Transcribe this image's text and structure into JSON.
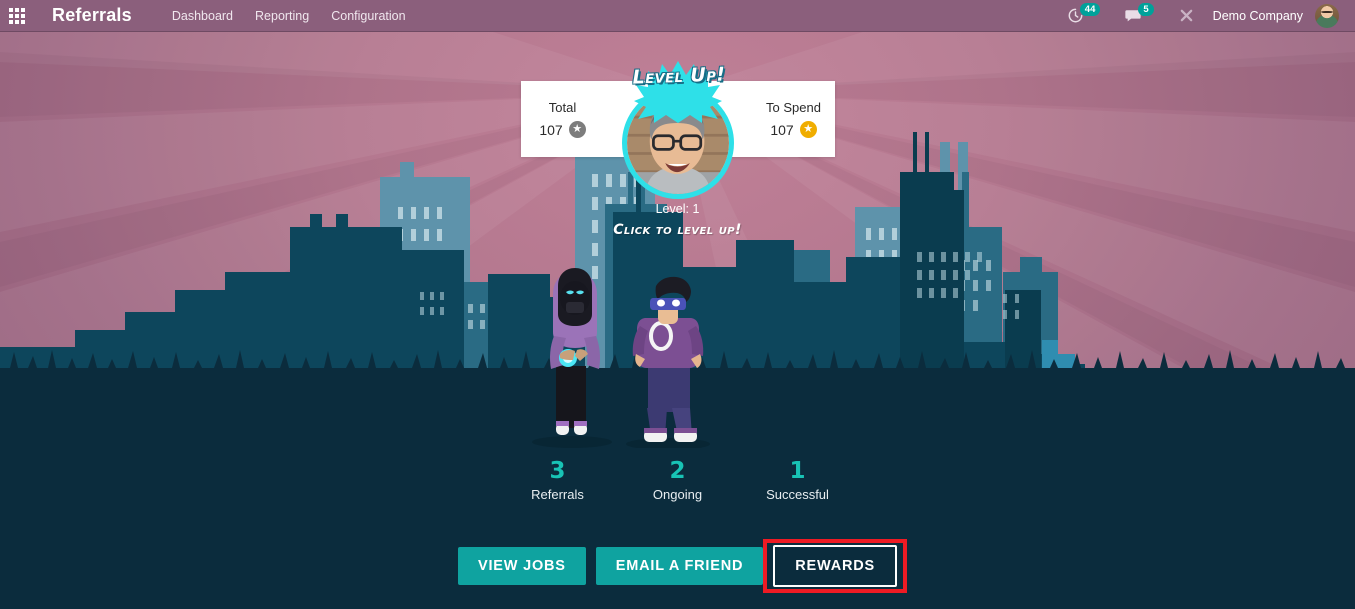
{
  "navbar": {
    "apps_icon": "apps-grid-icon",
    "brand": "Referrals",
    "menu": [
      {
        "label": "Dashboard"
      },
      {
        "label": "Reporting"
      },
      {
        "label": "Configuration"
      }
    ],
    "activities": {
      "icon": "clock-icon",
      "count": "44"
    },
    "messages": {
      "icon": "chat-bubble-icon",
      "count": "5"
    },
    "close_icon": "close-x-icon",
    "company": "Demo Company",
    "avatar_icon": "user-avatar"
  },
  "hero": {
    "levelup_banner": "Level Up!",
    "total": {
      "label": "Total",
      "value": "107",
      "icon": "grey-star-icon"
    },
    "to_spend": {
      "label": "To Spend",
      "value": "107",
      "icon": "gold-star-icon"
    },
    "level_caption": "Level: 1",
    "click_levelup": "Click to level up!",
    "avatar_icon": "profile-avatar"
  },
  "stats": [
    {
      "value": "3",
      "label": "Referrals"
    },
    {
      "value": "2",
      "label": "Ongoing"
    },
    {
      "value": "1",
      "label": "Successful"
    }
  ],
  "actions": [
    {
      "label": "VIEW JOBS",
      "style": "filled"
    },
    {
      "label": "EMAIL A FRIEND",
      "style": "filled"
    },
    {
      "label": "REWARDS",
      "style": "outline",
      "highlighted": true
    }
  ],
  "colors": {
    "navbar": "#8b5f7c",
    "accent_teal": "#0fa3a0",
    "stat_teal": "#18c3b5",
    "ground": "#0b2c3d",
    "sky": "#b4788f",
    "ring_cyan": "#2ee0e8",
    "highlight_red": "#ee1b24",
    "gold_star": "#f0ad00",
    "grey_star": "#7d7d7d"
  }
}
